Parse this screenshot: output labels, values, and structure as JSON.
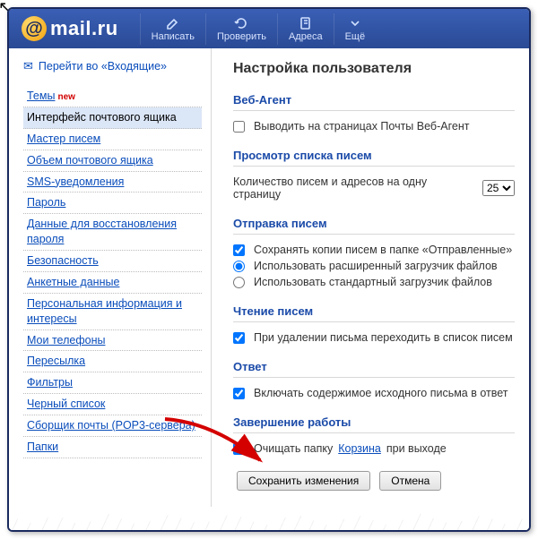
{
  "logo": {
    "text": "mail.ru"
  },
  "topnav": {
    "write": "Написать",
    "check": "Проверить",
    "addresses": "Адреса",
    "more": "Ещё"
  },
  "sidebar": {
    "inbox_link": "Перейти во «Входящие»",
    "items": [
      {
        "label": "Темы",
        "badge": "new"
      },
      {
        "label": "Интерфейс почтового ящика",
        "active": true
      },
      {
        "label": "Мастер писем"
      },
      {
        "label": "Объем почтового ящика"
      },
      {
        "label": "SMS-уведомления"
      },
      {
        "label": "Пароль"
      },
      {
        "label": "Данные для восстановления пароля"
      },
      {
        "label": "Безопасность"
      },
      {
        "label": "Анкетные данные"
      },
      {
        "label": "Персональная информация и интересы"
      },
      {
        "label": "Мои телефоны"
      },
      {
        "label": "Пересылка"
      },
      {
        "label": "Фильтры"
      },
      {
        "label": "Черный список"
      },
      {
        "label": "Сборщик почты (POP3-сервера)"
      },
      {
        "label": "Папки"
      }
    ]
  },
  "main": {
    "title": "Настройка пользователя",
    "sections": {
      "webagent": {
        "title": "Веб-Агент",
        "opt_show": "Выводить на страницах Почты Веб-Агент",
        "opt_show_checked": false
      },
      "listview": {
        "title": "Просмотр списка писем",
        "label": "Количество писем и адресов на одну страницу",
        "value": "25"
      },
      "send": {
        "title": "Отправка писем",
        "opt_savecopy": "Сохранять копии писем в папке «Отправленные»",
        "opt_savecopy_checked": true,
        "opt_adv": "Использовать расширенный загрузчик файлов",
        "opt_std": "Использовать стандартный загрузчик файлов",
        "uploader_selected": "adv"
      },
      "read": {
        "title": "Чтение писем",
        "opt_gotolist": "При удалении письма переходить в список писем",
        "opt_gotolist_checked": true
      },
      "reply": {
        "title": "Ответ",
        "opt_include": "Включать содержимое исходного письма в ответ",
        "opt_include_checked": true
      },
      "logout": {
        "title": "Завершение работы",
        "opt_clear_pre": "Очищать папку",
        "opt_clear_link": "Корзина",
        "opt_clear_post": "при выходе",
        "opt_clear_checked": true
      }
    },
    "buttons": {
      "save": "Сохранить изменения",
      "cancel": "Отмена"
    }
  }
}
